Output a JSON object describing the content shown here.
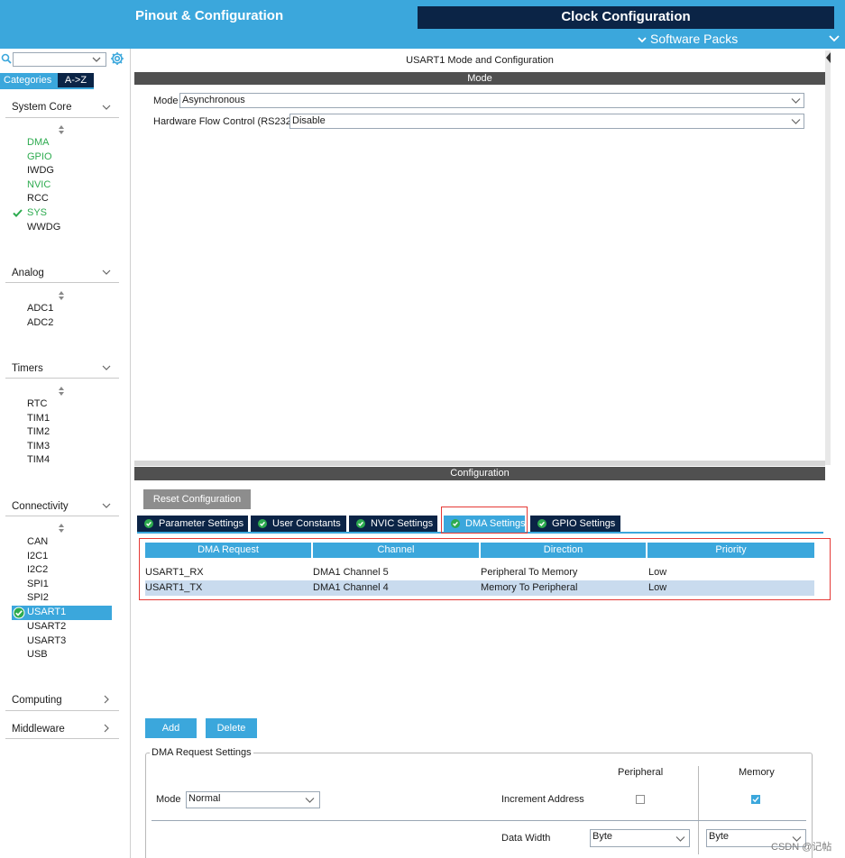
{
  "header": {
    "nav_pinout": "Pinout & Configuration",
    "nav_clock": "Clock Configuration",
    "software_packs": "Software Packs"
  },
  "sidebar": {
    "search": {
      "value": "",
      "placeholder": ""
    },
    "tab_categories": "Categories",
    "tab_az": "A->Z",
    "categories": [
      {
        "name": "System Core",
        "items": [
          "DMA",
          "GPIO",
          "IWDG",
          "NVIC",
          "RCC",
          "SYS",
          "WWDG"
        ]
      },
      {
        "name": "Analog",
        "items": [
          "ADC1",
          "ADC2"
        ]
      },
      {
        "name": "Timers",
        "items": [
          "RTC",
          "TIM1",
          "TIM2",
          "TIM3",
          "TIM4"
        ]
      },
      {
        "name": "Connectivity",
        "items": [
          "CAN",
          "I2C1",
          "I2C2",
          "SPI1",
          "SPI2",
          "USART1",
          "USART2",
          "USART3",
          "USB"
        ]
      },
      {
        "name": "Computing",
        "items": []
      },
      {
        "name": "Middleware",
        "items": []
      }
    ]
  },
  "mode_panel": {
    "title": "USART1 Mode and Configuration",
    "bar": "Mode",
    "mode_label": "Mode",
    "mode_value": "Asynchronous",
    "flow_label": "Hardware Flow Control (RS232)",
    "flow_value": "Disable"
  },
  "config_panel": {
    "bar": "Configuration",
    "reset_button": "Reset Configuration",
    "tabs": [
      "Parameter Settings",
      "User Constants",
      "NVIC Settings",
      "DMA Settings",
      "GPIO Settings"
    ],
    "active_tab": "DMA Settings",
    "table": {
      "headers": [
        "DMA Request",
        "Channel",
        "Direction",
        "Priority"
      ],
      "rows": [
        [
          "USART1_RX",
          "DMA1 Channel 5",
          "Peripheral To Memory",
          "Low"
        ],
        [
          "USART1_TX",
          "DMA1 Channel 4",
          "Memory To Peripheral",
          "Low"
        ]
      ],
      "selected_row": 1
    },
    "add_button": "Add",
    "delete_button": "Delete",
    "request_settings": {
      "title": "DMA Request Settings",
      "peripheral_header": "Peripheral",
      "memory_header": "Memory",
      "mode_label": "Mode",
      "mode_value": "Normal",
      "increment_label": "Increment Address",
      "increment_peripheral": false,
      "increment_memory": true,
      "data_width_label": "Data Width",
      "data_width_peripheral": "Byte",
      "data_width_memory": "Byte"
    }
  },
  "watermark": "CSDN @记帖",
  "colors": {
    "accent": "#3ba7dc",
    "navy": "#0b2446",
    "enabled": "#2dab4f",
    "highlight": "#e53935"
  }
}
